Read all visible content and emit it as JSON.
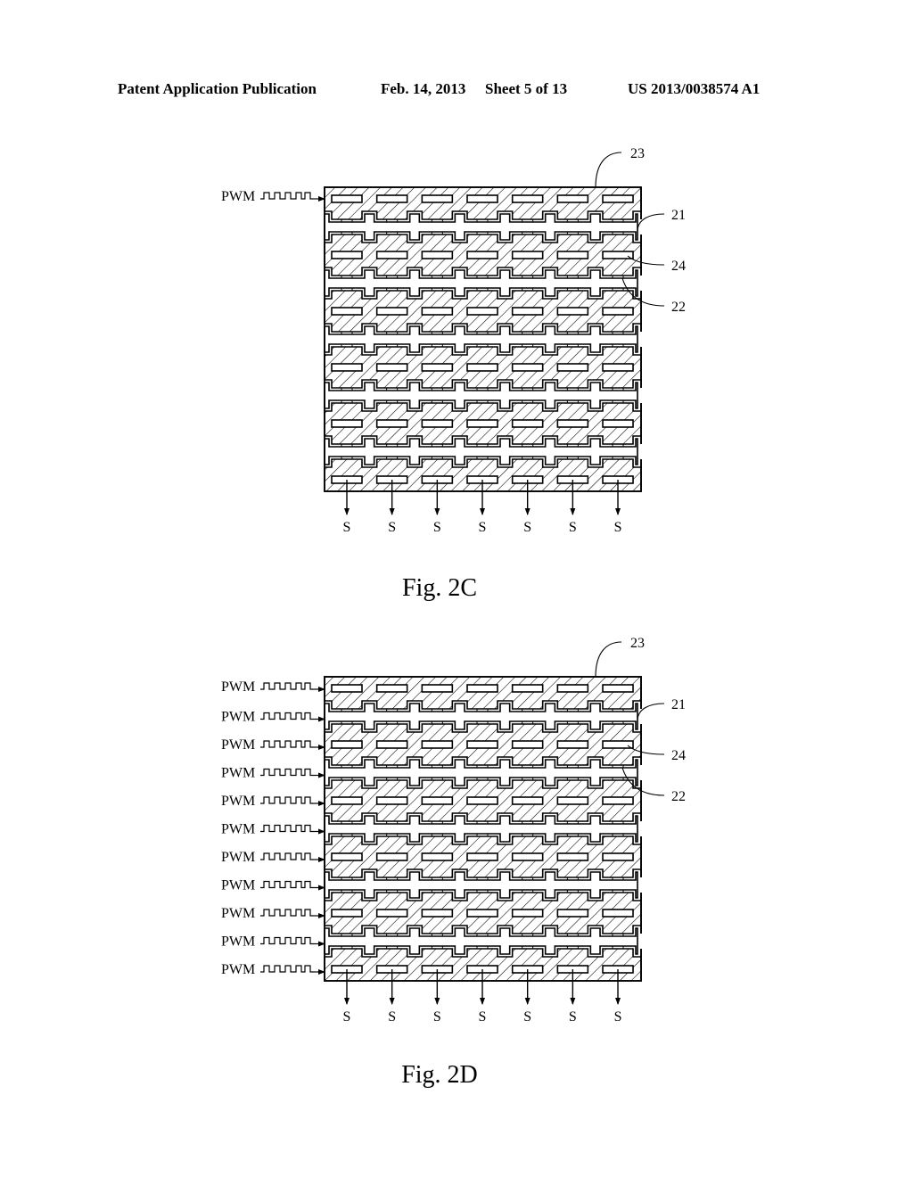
{
  "header": {
    "publication_type": "Patent Application Publication",
    "date": "Feb. 14, 2013",
    "sheet": "Sheet 5 of 13",
    "publication_number": "US 2013/0038574 A1"
  },
  "figures": [
    {
      "id": "fig-2c",
      "caption": "Fig. 2C",
      "columns": 7,
      "electrode_rows": 6,
      "input_label": "PWM",
      "input_count": 1,
      "output_label": "S",
      "output_count": 7,
      "reference_labels": [
        {
          "id": "23",
          "text": "23"
        },
        {
          "id": "21",
          "text": "21"
        },
        {
          "id": "24",
          "text": "24"
        },
        {
          "id": "22",
          "text": "22"
        }
      ]
    },
    {
      "id": "fig-2d",
      "caption": "Fig. 2D",
      "columns": 7,
      "electrode_rows": 6,
      "input_label": "PWM",
      "input_count": 11,
      "output_label": "S",
      "output_count": 7,
      "reference_labels": [
        {
          "id": "23",
          "text": "23"
        },
        {
          "id": "21",
          "text": "21"
        },
        {
          "id": "24",
          "text": "24"
        },
        {
          "id": "22",
          "text": "22"
        }
      ]
    }
  ]
}
